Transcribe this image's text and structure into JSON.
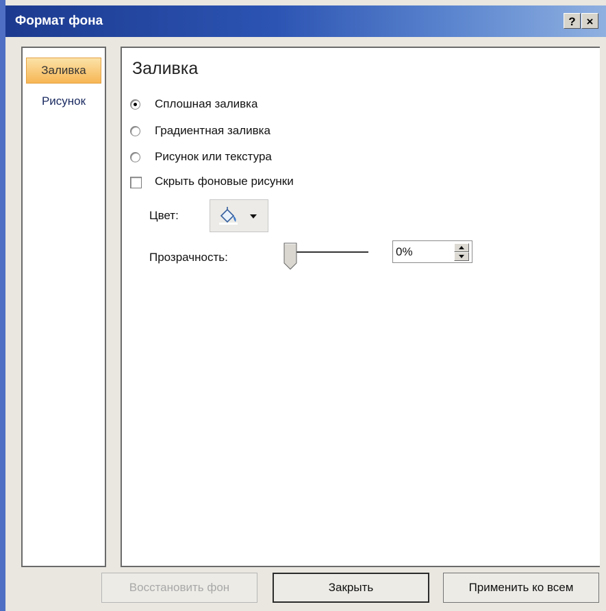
{
  "window": {
    "title": "Формат фона",
    "help_label": "?",
    "close_label": "×"
  },
  "sidebar": {
    "items": [
      {
        "label": "Заливка",
        "active": true
      },
      {
        "label": "Рисунок",
        "active": false
      }
    ]
  },
  "fill": {
    "section_title": "Заливка",
    "options": [
      {
        "label": "Сплошная заливка",
        "checked": true
      },
      {
        "label": "Градиентная заливка",
        "checked": false
      },
      {
        "label": "Рисунок или текстура",
        "checked": false
      }
    ],
    "hide_images": {
      "label": "Скрыть фоновые рисунки",
      "checked": false
    },
    "color": {
      "label": "Цвет:",
      "icon": "paint-bucket-icon"
    },
    "transparency": {
      "label": "Прозрачность:",
      "value": "0%",
      "slider_value": 0
    }
  },
  "buttons": {
    "reset": "Восстановить фон",
    "close": "Закрыть",
    "apply_all": "Применить ко всем"
  },
  "colors": {
    "titlebar_start": "#1c3a8f",
    "titlebar_end": "#8fb0e0",
    "active_tab": "#f7b654"
  }
}
